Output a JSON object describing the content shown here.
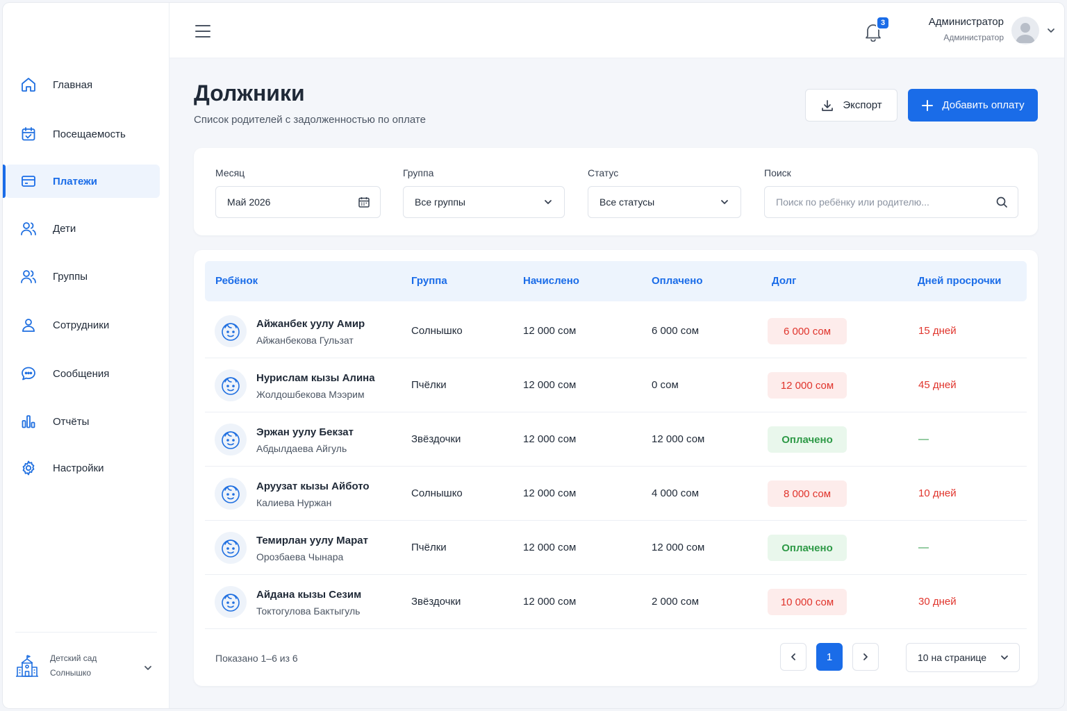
{
  "sidebar": {
    "items": [
      {
        "label": "Главная",
        "icon": "home-icon"
      },
      {
        "label": "Посещаемость",
        "icon": "calendar-check-icon"
      },
      {
        "label": "Платежи",
        "icon": "credit-card-icon",
        "active": true
      },
      {
        "label": "Дети",
        "icon": "users-icon"
      },
      {
        "label": "Группы",
        "icon": "users-icon"
      },
      {
        "label": "Сотрудники",
        "icon": "user-icon"
      },
      {
        "label": "Сообщения",
        "icon": "chat-icon"
      },
      {
        "label": "Отчёты",
        "icon": "bar-chart-icon"
      },
      {
        "label": "Настройки",
        "icon": "gear-icon"
      }
    ],
    "footer": {
      "line1": "Детский сад",
      "line2": "Солнышко"
    }
  },
  "topbar": {
    "notifications_count": "3",
    "user_name": "Администратор",
    "user_role": "Администратор"
  },
  "page": {
    "title": "Должники",
    "subtitle": "Список родителей с задолженностью по оплате",
    "export_label": "Экспорт",
    "add_label": "Добавить оплату"
  },
  "filters": {
    "month_label": "Месяц",
    "month_value": "Май 2026",
    "group_label": "Группа",
    "group_value": "Все группы",
    "status_label": "Статус",
    "status_value": "Все статусы",
    "search_label": "Поиск",
    "search_placeholder": "Поиск по ребёнку или родителю..."
  },
  "table": {
    "headers": [
      "Ребёнок",
      "Группа",
      "Начислено",
      "Оплачено",
      "Долг",
      "Дней просрочки"
    ],
    "rows": [
      {
        "child": "Айжанбек уулу Амир",
        "parent": "Айжанбекова Гульзат",
        "group": "Солнышко",
        "charged": "12 000 сом",
        "paid": "6 000 сом",
        "debt": "6 000 сом",
        "debt_status": "red",
        "days": "15 дней"
      },
      {
        "child": "Нурислам кызы Алина",
        "parent": "Жолдошбекова Мээрим",
        "group": "Пчёлки",
        "charged": "12 000 сом",
        "paid": "0 сом",
        "debt": "12 000 сом",
        "debt_status": "red",
        "days": "45 дней"
      },
      {
        "child": "Эржан уулу Бекзат",
        "parent": "Абдылдаева Айгуль",
        "group": "Звёздочки",
        "charged": "12 000 сом",
        "paid": "12 000 сом",
        "debt": "Оплачено",
        "debt_status": "green",
        "days": "—"
      },
      {
        "child": "Аруузат кызы Айбото",
        "parent": "Калиева Нуржан",
        "group": "Солнышко",
        "charged": "12 000 сом",
        "paid": "4 000 сом",
        "debt": "8 000 сом",
        "debt_status": "red",
        "days": "10 дней"
      },
      {
        "child": "Темирлан уулу Марат",
        "parent": "Орозбаева Чынара",
        "group": "Пчёлки",
        "charged": "12 000 сом",
        "paid": "12 000 сом",
        "debt": "Оплачено",
        "debt_status": "green",
        "days": "—"
      },
      {
        "child": "Айдана кызы Сезим",
        "parent": "Токтогулова Бактыгуль",
        "group": "Звёздочки",
        "charged": "12 000 сом",
        "paid": "2 000 сом",
        "debt": "10 000 сом",
        "debt_status": "red",
        "days": "30 дней"
      }
    ]
  },
  "pagination": {
    "shown": "Показано 1–6 из 6",
    "current_page": "1",
    "per_page": "10 на странице"
  },
  "colors": {
    "accent": "#1a6ce8",
    "debt_red": "#e0342c",
    "paid_green": "#2e9a47"
  }
}
